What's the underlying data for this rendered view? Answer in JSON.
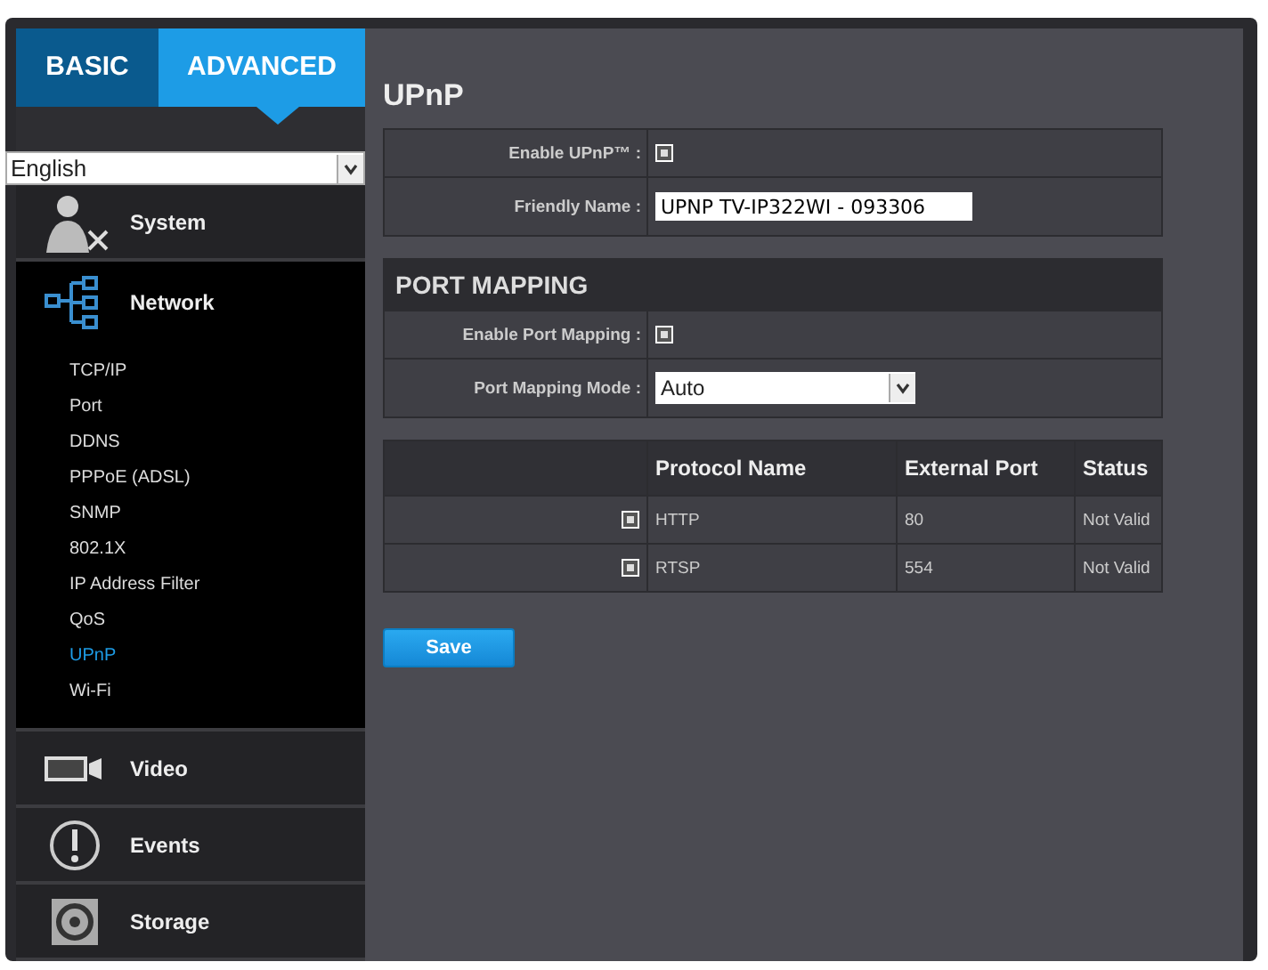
{
  "tabs": [
    {
      "label": "BASIC",
      "selected": false
    },
    {
      "label": "ADVANCED",
      "selected": true
    }
  ],
  "language": {
    "value": "English"
  },
  "menu": [
    {
      "label": "System",
      "expanded": false
    },
    {
      "label": "Network",
      "expanded": true,
      "children": [
        {
          "label": "TCP/IP",
          "selected": false
        },
        {
          "label": "Port",
          "selected": false
        },
        {
          "label": "DDNS",
          "selected": false
        },
        {
          "label": "PPPoE (ADSL)",
          "selected": false
        },
        {
          "label": "SNMP",
          "selected": false
        },
        {
          "label": "802.1X",
          "selected": false
        },
        {
          "label": "IP Address Filter",
          "selected": false
        },
        {
          "label": "QoS",
          "selected": false
        },
        {
          "label": "UPnP",
          "selected": true
        },
        {
          "label": "Wi-Fi",
          "selected": false
        }
      ]
    },
    {
      "label": "Video",
      "expanded": false
    },
    {
      "label": "Events",
      "expanded": false
    },
    {
      "label": "Storage",
      "expanded": false
    }
  ],
  "page_title": "UPnP",
  "upnp": {
    "rows": [
      {
        "kind": "checkbox",
        "label": "Enable UPnP™ :",
        "checked": true
      },
      {
        "kind": "text",
        "label": "Friendly Name :",
        "value": "UPNP TV-IP322WI - 093306"
      }
    ]
  },
  "port_mapping": {
    "title": "PORT MAPPING",
    "rows": [
      {
        "kind": "checkbox",
        "label": "Enable Port Mapping :",
        "checked": true
      },
      {
        "kind": "select",
        "label": "Port Mapping Mode :",
        "value": "Auto"
      }
    ]
  },
  "protocols": {
    "columns": [
      "Protocol Name",
      "External Port",
      "Status"
    ],
    "rows": [
      {
        "checked": true,
        "protocol": "HTTP",
        "port": "80",
        "status": "Not Valid"
      },
      {
        "checked": true,
        "protocol": "RTSP",
        "port": "554",
        "status": "Not Valid"
      }
    ]
  },
  "save_button": "Save"
}
